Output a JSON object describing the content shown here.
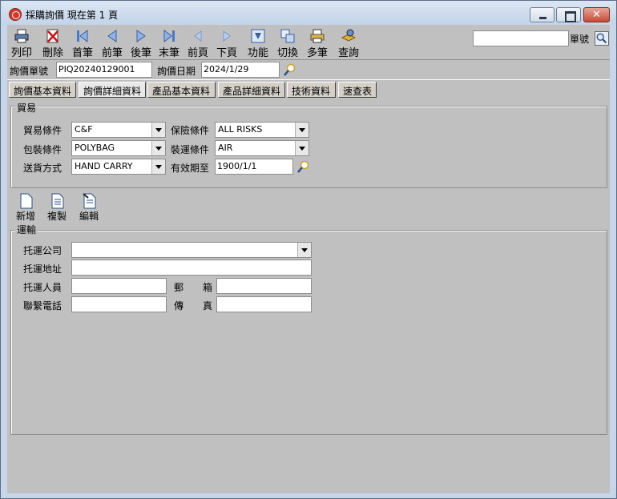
{
  "window": {
    "title": "採購詢價  現在第 1 頁"
  },
  "toolbar": {
    "items": [
      {
        "label": "列印",
        "icon": "printer-icon"
      },
      {
        "label": "刪除",
        "icon": "delete-icon"
      },
      {
        "label": "首筆",
        "icon": "first-record-icon"
      },
      {
        "label": "前筆",
        "icon": "previous-record-icon"
      },
      {
        "label": "後筆",
        "icon": "next-record-icon"
      },
      {
        "label": "末筆",
        "icon": "last-record-icon"
      },
      {
        "label": "前頁",
        "icon": "previous-page-icon"
      },
      {
        "label": "下頁",
        "icon": "next-page-icon"
      },
      {
        "label": "功能",
        "icon": "function-icon"
      },
      {
        "label": "切換",
        "icon": "switch-icon"
      },
      {
        "label": "多筆",
        "icon": "multi-record-icon"
      },
      {
        "label": "查詢",
        "icon": "query-icon"
      }
    ],
    "search_value": "",
    "search_label": "單號"
  },
  "header": {
    "inquiry_no_label": "詢價單號",
    "inquiry_no": "PIQ20240129001",
    "inquiry_date_label": "詢價日期",
    "inquiry_date": "2024/1/29"
  },
  "tabs": [
    {
      "label": "詢價基本資料",
      "active": false
    },
    {
      "label": "詢價詳細資料",
      "active": true
    },
    {
      "label": "產品基本資料",
      "active": false
    },
    {
      "label": "產品詳細資料",
      "active": false
    },
    {
      "label": "技術資料",
      "active": false
    },
    {
      "label": "速查表",
      "active": false
    }
  ],
  "trade": {
    "title": "貿易",
    "trade_terms_label": "貿易條件",
    "trade_terms": "C&F",
    "insurance_label": "保險條件",
    "insurance": "ALL RISKS",
    "packing_label": "包裝條件",
    "packing": "POLYBAG",
    "shipping_label": "裝運條件",
    "shipping": "AIR",
    "delivery_label": "送貨方式",
    "delivery": "HAND CARRY",
    "valid_until_label": "有效期至",
    "valid_until": "1900/1/1"
  },
  "actions": {
    "add_label": "新增",
    "copy_label": "複製",
    "edit_label": "編輯"
  },
  "transport": {
    "title": "運輸",
    "company_label": "托運公司",
    "company": "",
    "address_label": "托運地址",
    "address": "",
    "person_label": "托運人員",
    "person": "",
    "postal_label": "郵　　箱",
    "postal": "",
    "phone_label": "聯繫電話",
    "phone": "",
    "fax_label": "傳　　真",
    "fax": ""
  }
}
